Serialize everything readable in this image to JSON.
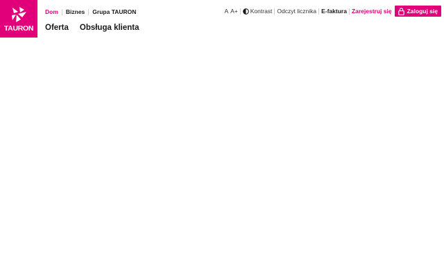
{
  "brand": {
    "name": "TAURON",
    "color": "#e2007a"
  },
  "segments": [
    {
      "label": "Dom",
      "active": true
    },
    {
      "label": "Biznes",
      "active": false
    },
    {
      "label": "Grupa TAURON",
      "active": false
    }
  ],
  "main_nav": [
    {
      "label": "Oferta"
    },
    {
      "label": "Obsługa klienta"
    }
  ],
  "utility": {
    "font_small": "A",
    "font_large": "A+",
    "contrast": "Kontrast",
    "meter_reading": "Odczyt licznika",
    "e_invoice": "E-faktura",
    "register": "Zarejestruj się",
    "login": "Zaloguj się",
    "icons": {
      "contrast": "half-circle-icon",
      "login": "lock-icon"
    }
  }
}
